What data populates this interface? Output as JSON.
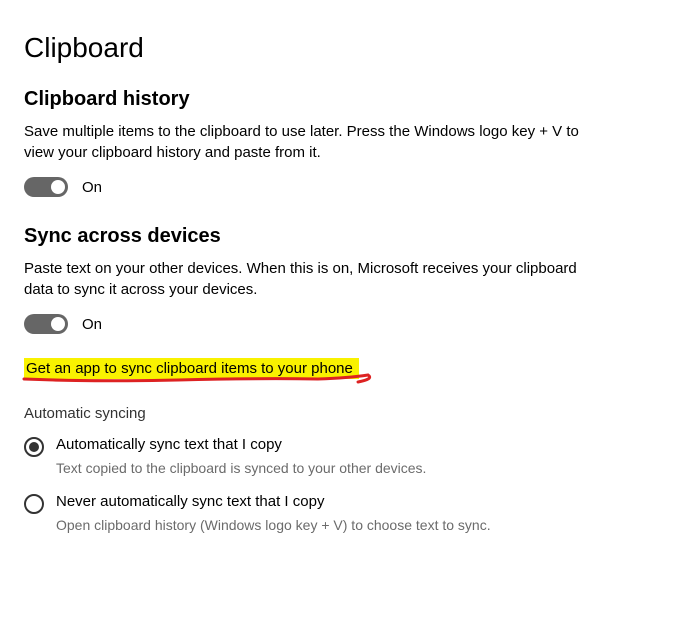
{
  "page": {
    "title": "Clipboard"
  },
  "sections": {
    "history": {
      "heading": "Clipboard history",
      "desc": "Save multiple items to the clipboard to use later. Press the Windows logo key + V to view your clipboard history and paste from it.",
      "toggle": {
        "state": "On"
      }
    },
    "sync": {
      "heading": "Sync across devices",
      "desc": "Paste text on your other devices. When this is on, Microsoft receives your clipboard data to sync it across your devices.",
      "toggle": {
        "state": "On"
      },
      "link": "Get an app to sync clipboard items to your phone",
      "autoSyncHeading": "Automatic syncing",
      "radios": {
        "auto": {
          "label": "Automatically sync text that I copy",
          "desc": "Text copied to the clipboard is synced to your other devices."
        },
        "never": {
          "label": "Never automatically sync text that I copy",
          "desc": "Open clipboard history (Windows logo key + V) to choose text to sync."
        }
      }
    }
  }
}
